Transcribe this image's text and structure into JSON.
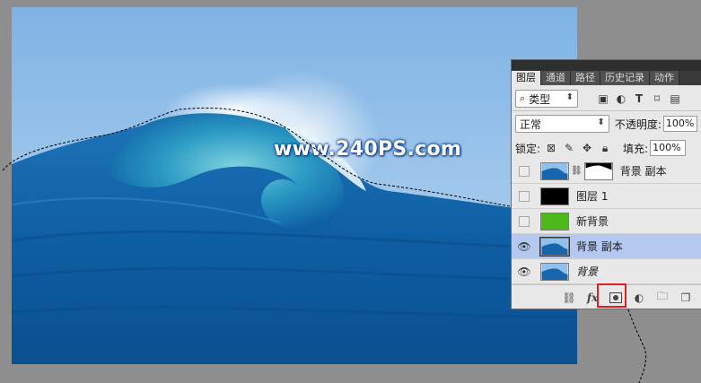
{
  "watermark": "www.240PS.com",
  "panel": {
    "tabs": [
      "图层",
      "通道",
      "路径",
      "历史记录",
      "动作"
    ],
    "filter": {
      "label": "类型"
    },
    "blend_mode": "正常",
    "opacity_label": "不透明度:",
    "opacity_value": "100%",
    "lock_label": "锁定:",
    "fill_label": "填充:",
    "fill_value": "100%",
    "layers": [
      {
        "name": "背景 副本",
        "visible": false,
        "thumb": "wave",
        "has_mask": true
      },
      {
        "name": "图层 1",
        "visible": false,
        "thumb": "black"
      },
      {
        "name": "新背景",
        "visible": false,
        "thumb": "green"
      },
      {
        "name": "背景 副本",
        "visible": true,
        "thumb": "wave",
        "selected": true
      },
      {
        "name": "背景",
        "visible": true,
        "thumb": "wave",
        "italic": true
      }
    ],
    "bottom_icons": [
      "link-icon",
      "fx-icon",
      "add-mask-icon",
      "adjustment-icon",
      "folder-icon",
      "new-layer-icon"
    ]
  },
  "colors": {
    "workspace": "#8e8e8e",
    "selected_layer": "#b4c8f0",
    "highlight": "#e02020",
    "green_fill": "#4cb81a"
  }
}
